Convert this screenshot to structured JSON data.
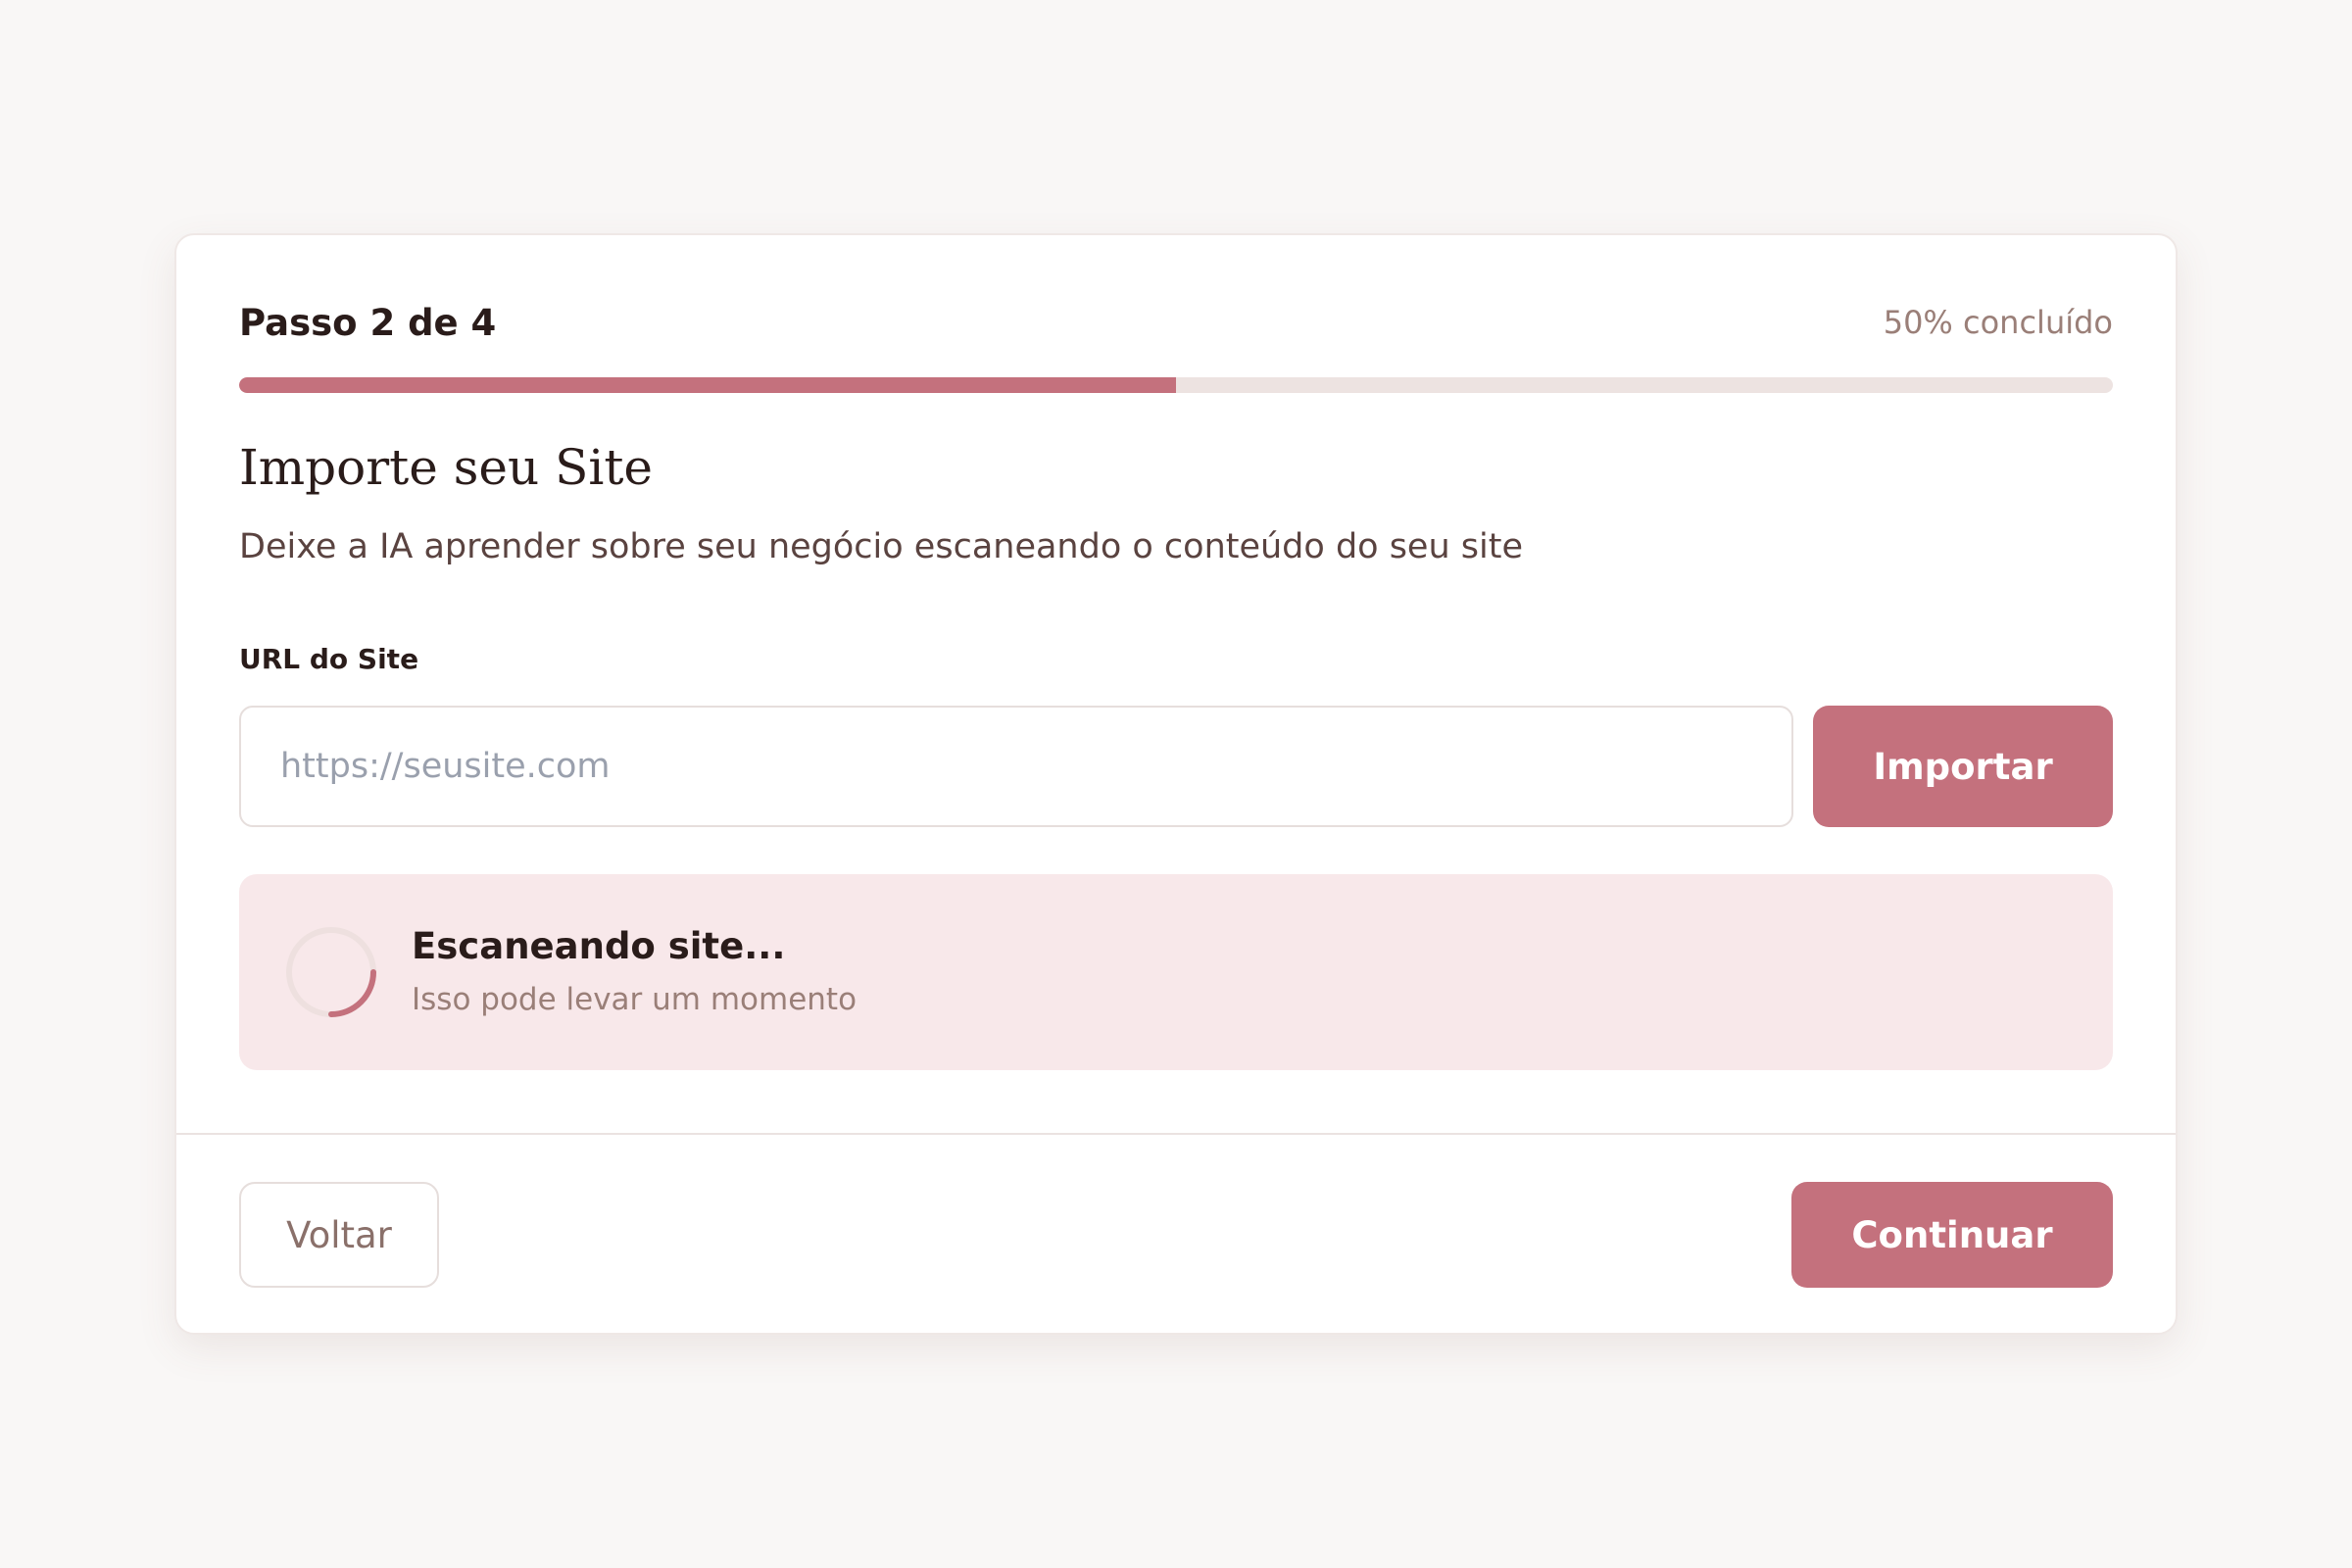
{
  "progress": {
    "step_label": "Passo 2 de 4",
    "percent_label": "50% concluído",
    "fraction": 0.5
  },
  "header": {
    "title": "Importe seu Site",
    "subtitle": "Deixe a IA aprender sobre seu negócio escaneando o conteúdo do seu site"
  },
  "form": {
    "url_label": "URL do Site",
    "url_value": "",
    "url_placeholder": "https://seusite.com",
    "import_button": "Importar"
  },
  "status": {
    "title": "Escaneando site...",
    "subtitle": "Isso pode levar um momento",
    "icon": "loading-spinner-icon"
  },
  "footer": {
    "back_button": "Voltar",
    "continue_button": "Continuar"
  },
  "colors": {
    "accent": "#c4717d",
    "track": "#ede3e1",
    "status_bg": "#f8e8ea",
    "background": "#f9f7f6"
  }
}
